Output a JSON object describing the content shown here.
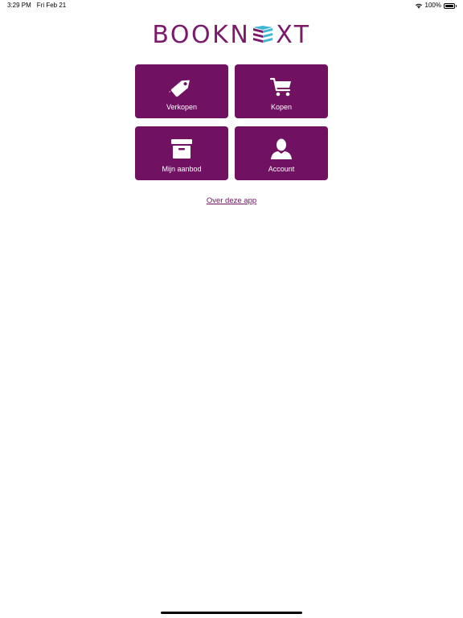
{
  "status_bar": {
    "time": "3:29 PM",
    "date": "Fri Feb 21",
    "battery": "100%",
    "battery_level": 1.0
  },
  "logo": {
    "text_left": "BOOKN",
    "text_right": "XT",
    "brand_color": "#7b1a6b",
    "accent_color": "#3fb6d3"
  },
  "tiles": [
    {
      "label": "Verkopen",
      "icon": "price-tag-icon"
    },
    {
      "label": "Kopen",
      "icon": "shopping-cart-icon"
    },
    {
      "label": "Mijn aanbod",
      "icon": "archive-box-icon"
    },
    {
      "label": "Account",
      "icon": "user-icon"
    }
  ],
  "tile_color": "#711162",
  "about_link": "Over deze app"
}
